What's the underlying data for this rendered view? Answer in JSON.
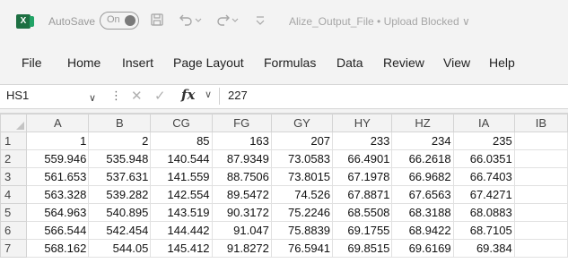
{
  "titlebar": {
    "app_icon": "excel-icon",
    "app_letter": "X",
    "autosave_label": "AutoSave",
    "toggle_state": "On",
    "save_icon": "save-icon",
    "undo_icon": "undo-icon",
    "redo_icon": "redo-icon",
    "customize_icon": "customize-quick-access-icon",
    "document_title": "Alize_Output_File • Upload Blocked ∨"
  },
  "ribbon": {
    "tabs": [
      "File",
      "Home",
      "Insert",
      "Page Layout",
      "Formulas",
      "Data",
      "Review",
      "View",
      "Help"
    ]
  },
  "formula_bar": {
    "name_box": "HS1",
    "formula_value": "227"
  },
  "sheet": {
    "columns": [
      "A",
      "B",
      "CG",
      "FG",
      "GY",
      "HY",
      "HZ",
      "IA",
      "IB"
    ],
    "rows": [
      {
        "row": "1",
        "cells": [
          "1",
          "2",
          "85",
          "163",
          "207",
          "233",
          "234",
          "235",
          ""
        ]
      },
      {
        "row": "2",
        "cells": [
          "559.946",
          "535.948",
          "140.544",
          "87.9349",
          "73.0583",
          "66.4901",
          "66.2618",
          "66.0351",
          ""
        ]
      },
      {
        "row": "3",
        "cells": [
          "561.653",
          "537.631",
          "141.559",
          "88.7506",
          "73.8015",
          "67.1978",
          "66.9682",
          "66.7403",
          ""
        ]
      },
      {
        "row": "4",
        "cells": [
          "563.328",
          "539.282",
          "142.554",
          "89.5472",
          "74.526",
          "67.8871",
          "67.6563",
          "67.4271",
          ""
        ]
      },
      {
        "row": "5",
        "cells": [
          "564.963",
          "540.895",
          "143.519",
          "90.3172",
          "75.2246",
          "68.5508",
          "68.3188",
          "68.0883",
          ""
        ]
      },
      {
        "row": "6",
        "cells": [
          "566.544",
          "542.454",
          "144.442",
          "91.047",
          "75.8839",
          "69.1755",
          "68.9422",
          "68.7105",
          ""
        ]
      },
      {
        "row": "7",
        "cells": [
          "568.162",
          "544.05",
          "145.412",
          "91.8272",
          "76.5941",
          "69.8515",
          "69.6169",
          "69.384",
          ""
        ]
      }
    ]
  }
}
